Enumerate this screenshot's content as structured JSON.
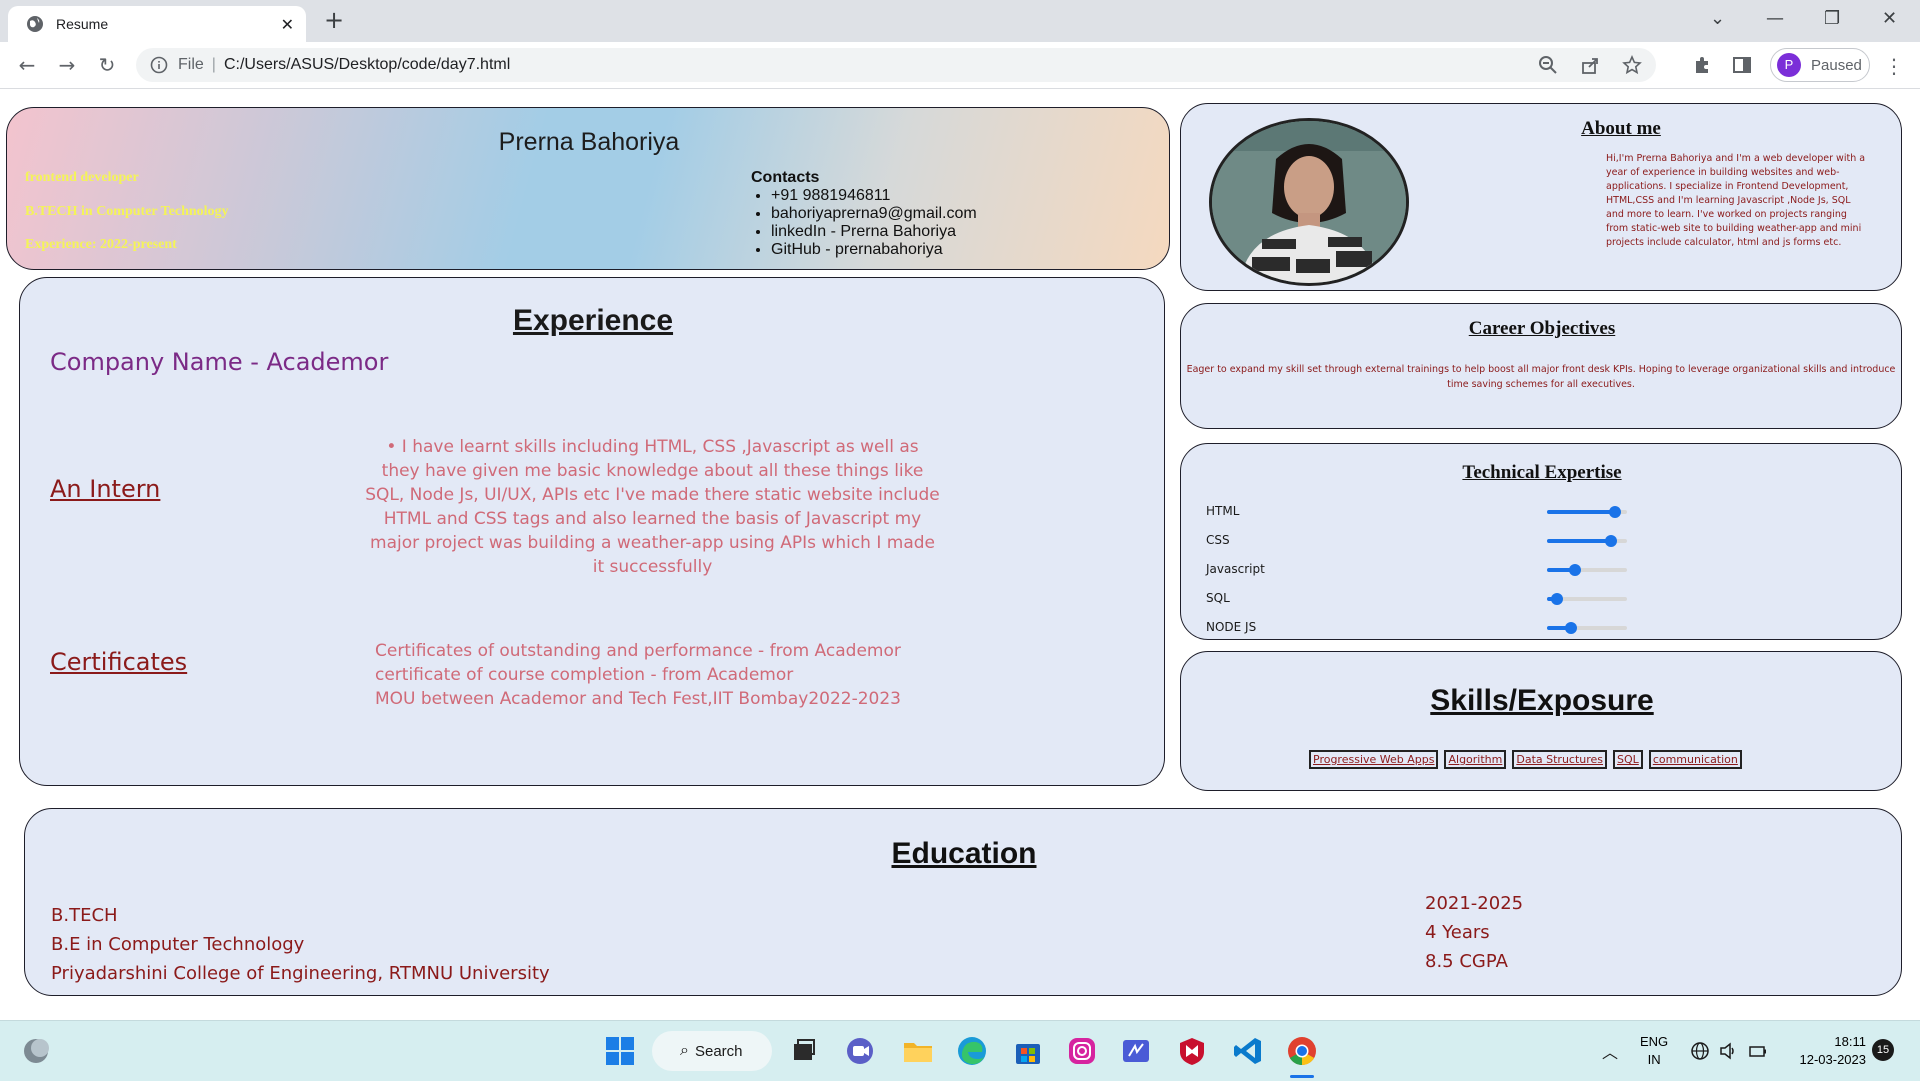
{
  "browser": {
    "tab_title": "Resume",
    "scheme_label": "File",
    "url": "C:/Users/ASUS/Desktop/code/day7.html",
    "profile_initial": "P",
    "profile_status": "Paused"
  },
  "header": {
    "name": "Prerna Bahoriya",
    "role": "frontend developer",
    "degree": "B.TECH in Computer Technology",
    "experience": "Experience: 2022-present",
    "contacts_title": "Contacts",
    "contacts": [
      "+91 9881946811",
      "bahoriyaprerna9@gmail.com",
      "linkedIn - Prerna Bahoriya",
      "GitHub - prernabahoriya"
    ]
  },
  "experience": {
    "title": "Experience",
    "company": "Company Name - Academor",
    "role": "An Intern",
    "description": "• I have learnt skills including HTML, CSS ,Javascript as well as they have given me basic knowledge about all these things like SQL, Node Js, UI/UX, APIs etc I've made there static website include HTML and CSS tags and also learned the basis of Javascript my major project was building a weather-app using APIs which I made it successfully",
    "certificates_title": "Certificates",
    "certificates": [
      "Certificates of outstanding and performance - from Academor",
      "certificate of course completion - from Academor",
      "MOU between Academor and Tech Fest,IIT Bombay2022-2023"
    ]
  },
  "about": {
    "title": "About me",
    "text": "Hi,I'm Prerna Bahoriya and I'm a web developer with a year of experience in building websites and web-applications. I specialize in Frontend Development, HTML,CSS and I'm learning Javascript ,Node Js, SQL and more to learn. I've worked on projects ranging from static-web site to building weather-app and mini projects include calculator, html and js forms etc."
  },
  "career": {
    "title": "Career Objectives",
    "text": "Eager to expand my skill set through external trainings to help boost all major front desk KPIs. Hoping to leverage organizational skills and introduce time saving schemes for all executives."
  },
  "technical": {
    "title": "Technical Expertise",
    "skills": [
      {
        "name": "HTML",
        "level": 0.85
      },
      {
        "name": "CSS",
        "level": 0.8
      },
      {
        "name": "Javascript",
        "level": 0.35
      },
      {
        "name": "SQL",
        "level": 0.12
      },
      {
        "name": "NODE JS",
        "level": 0.3
      }
    ]
  },
  "skills": {
    "title": "Skills/Exposure",
    "tags": [
      "Progressive Web Apps",
      "Algorithm",
      "Data Structures",
      "SQL",
      "communication"
    ]
  },
  "education": {
    "title": "Education",
    "left": [
      "B.TECH",
      "B.E in Computer Technology",
      "Priyadarshini College of Engineering, RTMNU University"
    ],
    "right": [
      "2021-2025",
      "4 Years",
      "8.5 CGPA"
    ]
  },
  "taskbar": {
    "search_label": "Search",
    "lang_top": "ENG",
    "lang_bottom": "IN",
    "time": "18:11",
    "date": "12-03-2023",
    "notification_count": "15"
  },
  "colors": {
    "card_bg": "#e3e9f6",
    "accent_red": "#8b1a1a",
    "accent_pink": "#d06a78",
    "accent_purple": "#7b2a86",
    "header_yellow": "#f4f458"
  }
}
